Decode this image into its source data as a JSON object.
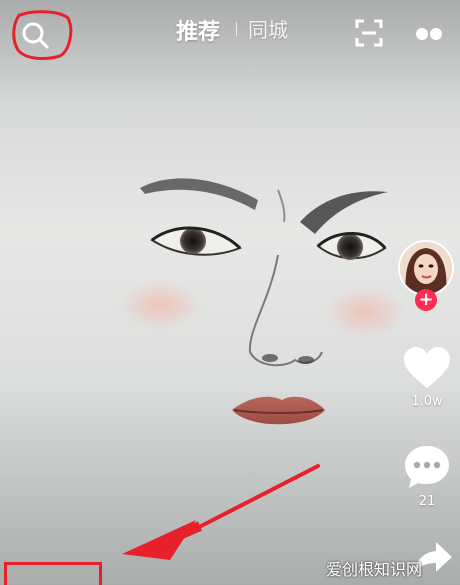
{
  "topbar": {
    "tab_recommend": "推荐",
    "tab_city": "同城",
    "icons": [
      "search-icon",
      "scan-icon",
      "more-icon"
    ]
  },
  "sidebar": {
    "like_count": "1.0w",
    "comment_count": "21",
    "follow_symbol": "+"
  },
  "watermark": "爱创根知识网",
  "colors": {
    "annotation_red": "#e8202a",
    "follow_red": "#fe2c55",
    "icon_white": "#ffffff"
  }
}
